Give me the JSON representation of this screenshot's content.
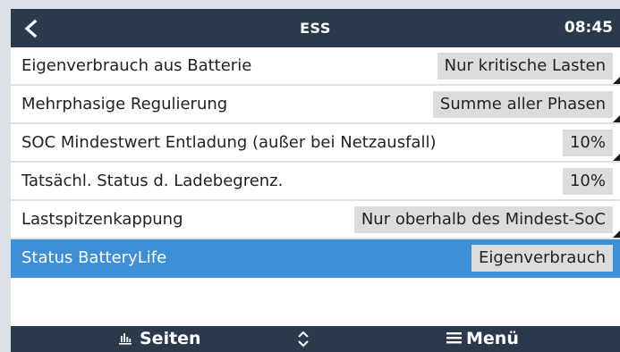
{
  "header": {
    "back_icon": "chevron-left-icon",
    "title": "ESS",
    "time": "08:45"
  },
  "rows": [
    {
      "label": "Eigenverbrauch aus Batterie",
      "value": "Nur kritische Lasten",
      "has_submenu": true
    },
    {
      "label": "Mehrphasige Regulierung",
      "value": "Summe aller Phasen",
      "has_submenu": true
    },
    {
      "label": "SOC Mindestwert Entladung (außer bei Netzausfall)",
      "value": "10%",
      "has_submenu": true
    },
    {
      "label": "Tatsächl. Status d. Ladebegrenz.",
      "value": "10%",
      "has_submenu": false
    },
    {
      "label": "Lastspitzenkappung",
      "value": "Nur oberhalb des Mindest-SoC",
      "has_submenu": true
    },
    {
      "label": "Status BatteryLife",
      "value": "Eigenverbrauch",
      "selected": true
    }
  ],
  "footer": {
    "pages_label": "Seiten",
    "pages_icon": "bar-chart-icon",
    "updown_icon": "up-down-chevron-icon",
    "menu_label": "Menü",
    "menu_icon": "hamburger-icon"
  },
  "colors": {
    "bar": "#2b3a4a",
    "selected": "#3d8fd8",
    "value_bg": "#dcdcdc",
    "divider": "#dbe1e6"
  }
}
